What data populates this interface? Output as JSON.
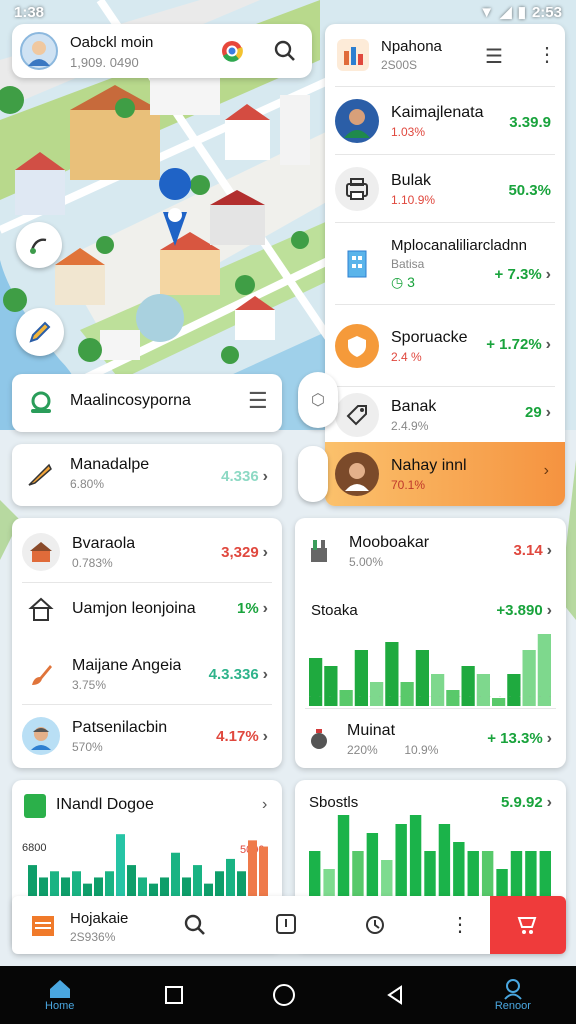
{
  "status": {
    "time": "1:38",
    "battery": "2:53"
  },
  "search": {
    "title": "Oabckl moin",
    "subtitle": "1,909. 0490"
  },
  "rightpanel": {
    "header": {
      "title": "Npahona",
      "subtitle": "2S00S"
    },
    "items": [
      {
        "name": "Kaimajlenata",
        "sub": "1.03%",
        "value": "3.39.9",
        "valueColor": "green",
        "sub_color": "red"
      },
      {
        "name": "Bulak",
        "sub": "1.10.9%",
        "value": "50.3%",
        "valueColor": "green",
        "sub_color": "red"
      },
      {
        "name": "Mplocanaliliarcladnn",
        "sub": "Batisa",
        "extra": "3",
        "value": "+ 7.3%",
        "valueColor": "green"
      },
      {
        "name": "Sporuacke",
        "sub": "2.4 %",
        "value": "+ 1.72%",
        "valueColor": "green"
      },
      {
        "name": "Banak",
        "sub": "2.4.9%",
        "value": "29",
        "valueColor": "green"
      }
    ],
    "highlight": {
      "name": "Nahay innl",
      "sub": "70.1%"
    }
  },
  "leftlist": {
    "header": "Maalincosyporna",
    "first": {
      "name": "Manadalpe",
      "sub": "6.80%",
      "value": "4.336"
    },
    "items": [
      {
        "name": "Bvaraola",
        "sub": "0.783%",
        "value": "3,329",
        "color": "red"
      },
      {
        "name": "Uamjon leonjoina",
        "sub": "",
        "value": "1%",
        "color": "green"
      },
      {
        "name": "Maijane Angeia",
        "sub": "3.75%",
        "value": "4.3.336",
        "color": "green"
      },
      {
        "name": "Patsenilacbin",
        "sub": "570%",
        "value": "4.17%",
        "color": "red"
      }
    ]
  },
  "rightcard": {
    "title": "Mooboakar",
    "sub": "5.00%",
    "value": "3.14",
    "sub2": "Stoaka",
    "value2": "+3.890",
    "chart_data": {
      "type": "bar",
      "values": [
        6,
        5,
        2,
        7,
        3,
        8,
        3,
        7,
        4,
        2,
        5,
        4,
        1,
        4,
        7,
        9
      ],
      "colors": [
        "#1faa3f",
        "#1faa3f",
        "#59c96a",
        "#1faa3f",
        "#7ed88d",
        "#1faa3f",
        "#59c96a",
        "#1faa3f",
        "#7ed88d",
        "#59c96a",
        "#1faa3f",
        "#7ed88d",
        "#59c96a",
        "#1faa3f",
        "#7ed88d",
        "#7ed88d"
      ],
      "ylim": [
        0,
        10
      ]
    },
    "foot": {
      "name": "Muinat",
      "sub": "220%",
      "mid": "10.9%",
      "value": "+ 13.3%"
    }
  },
  "bottomleft": {
    "title": "INandl Dogoe",
    "ylabel": "6800",
    "tag": "5000",
    "chart_data": {
      "type": "bar",
      "values": [
        5,
        3,
        4,
        3,
        4,
        2,
        3,
        4,
        10,
        5,
        3,
        2,
        3,
        7,
        3,
        5,
        2,
        4,
        6,
        4,
        9,
        8
      ],
      "colors": [
        "#0e9e6a",
        "#0e9e6a",
        "#19b383",
        "#0e9e6a",
        "#19b383",
        "#0e9e6a",
        "#0e9e6a",
        "#19b383",
        "#26c4a5",
        "#0e9e6a",
        "#19b383",
        "#0e9e6a",
        "#0e9e6a",
        "#19b383",
        "#0e9e6a",
        "#19b383",
        "#0e9e6a",
        "#0e9e6a",
        "#19b383",
        "#0e9e6a",
        "#ef7a4a",
        "#ef7a4a"
      ],
      "ylim": [
        0,
        11
      ]
    }
  },
  "bottomright": {
    "title": "Sbostls",
    "value": "5.9.92",
    "chart_data": {
      "type": "bar",
      "values": [
        5,
        3,
        9,
        5,
        7,
        4,
        8,
        9,
        5,
        8,
        6,
        5,
        5,
        3,
        5,
        5,
        5
      ],
      "colors": [
        "#1bb34a",
        "#7edb8f",
        "#1bb34a",
        "#57c96a",
        "#1bb34a",
        "#7edb8f",
        "#1bb34a",
        "#1bb34a",
        "#1bb34a",
        "#1bb34a",
        "#1bb34a",
        "#1bb34a",
        "#57c96a",
        "#1bb34a",
        "#1bb34a",
        "#1bb34a",
        "#1bb34a"
      ],
      "ylim": [
        0,
        10
      ]
    }
  },
  "toolbar": {
    "name": "Hojakaie",
    "sub": "2S936%"
  },
  "nav": {
    "home": "Home",
    "profile": "Renoor"
  },
  "colors": {
    "accent": "#19a33c",
    "red": "#e0483e",
    "orange": "#f7a24a"
  }
}
